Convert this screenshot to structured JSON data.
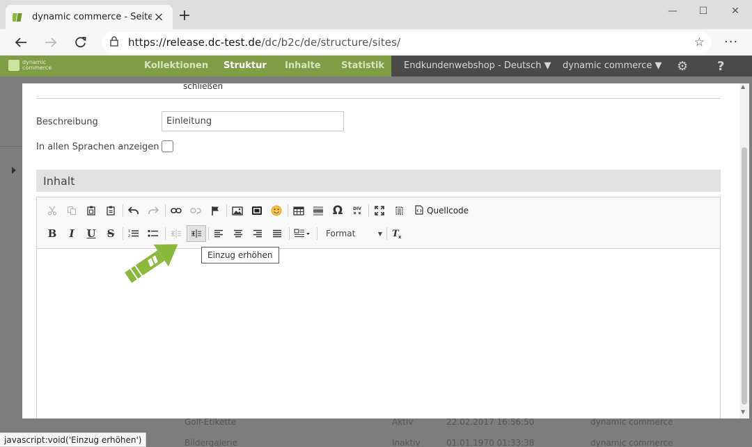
{
  "browser": {
    "tab_title": "dynamic commerce - Seiten",
    "tab_close": "×",
    "new_tab": "+",
    "url_prefix": "https://",
    "url_host": "release.dc-test.de",
    "url_path": "/dc/b2c/de/structure/sites/",
    "menu": "···",
    "window_controls": {
      "minimize": "—",
      "maximize": "☐",
      "close": "✕"
    }
  },
  "app": {
    "logo_text_1": "dynamic",
    "logo_text_2": "commerce",
    "nav": [
      "Kollektionen",
      "Struktur",
      "Inhalte",
      "Statistik"
    ],
    "active_nav": "Struktur",
    "shop_select": "Endkundenwebshop - Deutsch",
    "user_select": "dynamic commerce",
    "help": "?",
    "colors": {
      "green": "#7f9d44",
      "dark": "#4a4a4a",
      "arrow_green": "#8ab83b"
    }
  },
  "background_rows": [
    {
      "name": "Golf-Etikette",
      "status": "Aktiv",
      "date": "22.02.2017 16:56:50",
      "user": "dynamic commerce"
    },
    {
      "name": "Bildergalerie",
      "status": "Inaktiv",
      "date": "01.01.1970 01:33:38",
      "user": "dynamic commerce"
    }
  ],
  "modal": {
    "hint_text": "schließen",
    "fields": {
      "description_label": "Beschreibung",
      "description_value": "Einleitung",
      "all_languages_label": "In allen Sprachen anzeigen"
    },
    "section_title": "Inhalt"
  },
  "editor": {
    "source_label": "Quellcode",
    "format_label": "Format",
    "bold": "B",
    "italic": "I",
    "underline": "U",
    "strike": "S",
    "tooltip": "Einzug erhöhen"
  },
  "statusbar_text": "javascript:void('Einzug erhöhen')"
}
